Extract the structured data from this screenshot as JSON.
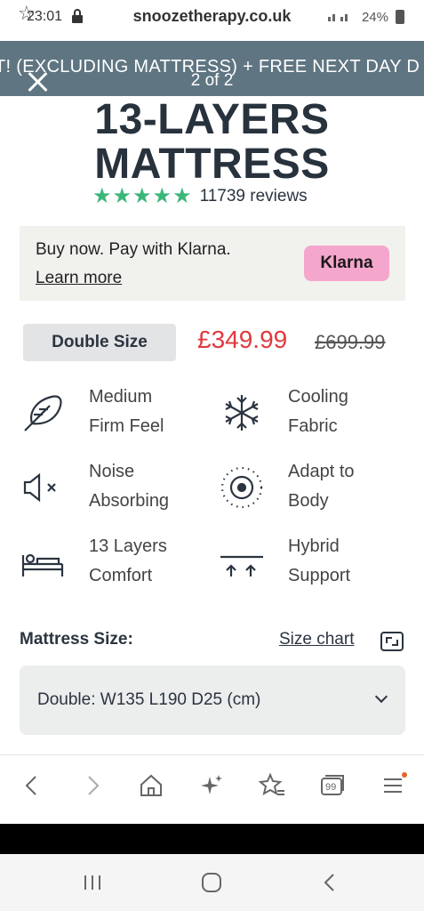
{
  "status": {
    "time": "23:01",
    "url": "snoozetherapy.co.uk",
    "battery": "24%"
  },
  "promo": {
    "text": "T! (EXCLUDING MATTRESS) + FREE NEXT DAY D",
    "counter": "2 of 2"
  },
  "product": {
    "title_line1": "13-LAYERS",
    "title_line2": "MATTRESS",
    "stars": "★★★★★",
    "reviews": "11739 reviews"
  },
  "klarna": {
    "text": "Buy now. Pay with Klarna.",
    "learn_more": "Learn more",
    "badge": "Klarna"
  },
  "pricing": {
    "size": "Double Size",
    "price": "£349.99",
    "old_price": "£699.99"
  },
  "features": [
    {
      "line1": "Medium",
      "line2": "Firm Feel",
      "icon": "feather-icon"
    },
    {
      "line1": "Cooling",
      "line2": "Fabric",
      "icon": "snowflake-icon"
    },
    {
      "line1": "Noise",
      "line2": "Absorbing",
      "icon": "mute-icon"
    },
    {
      "line1": "Adapt to",
      "line2": "Body",
      "icon": "target-icon"
    },
    {
      "line1": "13 Layers",
      "line2": "Comfort",
      "icon": "bed-icon"
    },
    {
      "line1": "Hybrid",
      "line2": "Support",
      "icon": "support-arrows-icon"
    }
  ],
  "size_select": {
    "label": "Mattress Size:",
    "size_chart": "Size chart",
    "value": "Double: W135 L190 D25 (cm)"
  },
  "browser": {
    "tabs_count": "99"
  },
  "colors": {
    "promo_bg": "#5f7582",
    "price_red": "#e0393e",
    "star_green": "#3cb77a",
    "klarna_pink": "#f5a6cc"
  }
}
